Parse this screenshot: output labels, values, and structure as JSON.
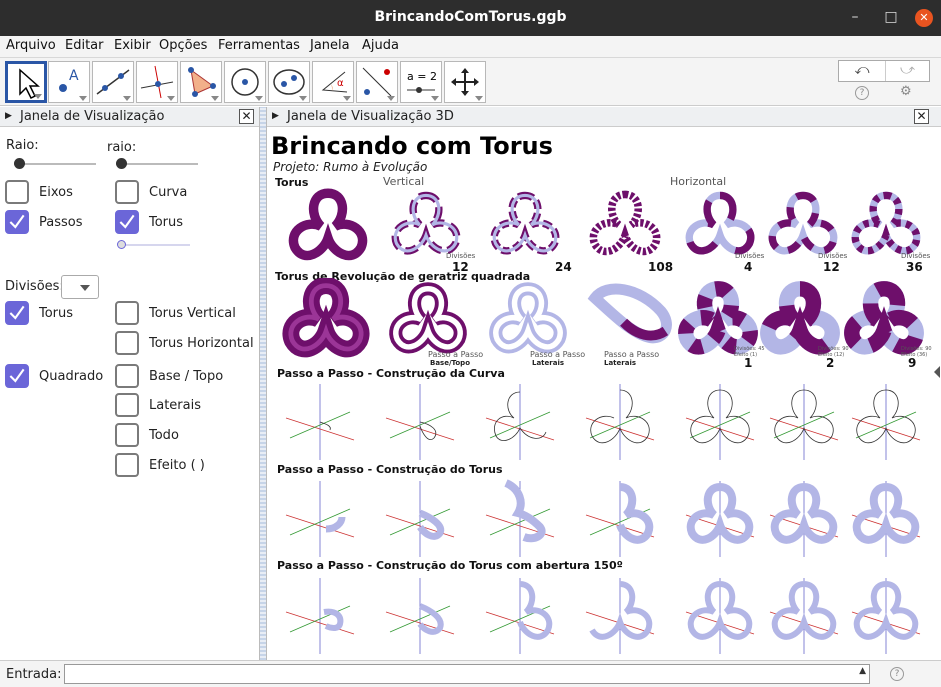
{
  "window": {
    "title": "BrincandoComTorus.ggb",
    "minimize": "–",
    "maximize": "□",
    "close": "✕"
  },
  "menu": [
    "Arquivo",
    "Editar",
    "Exibir",
    "Opções",
    "Ferramentas",
    "Janela",
    "Ajuda"
  ],
  "toolbar": {
    "tool7_label": "a = 2"
  },
  "left_panel": {
    "title": "Janela de Visualização",
    "raio_label": "Raio:",
    "raio2_label": "raio:",
    "eixos": "Eixos",
    "passos": "Passos",
    "curva": "Curva",
    "torus": "Torus",
    "divisoes": "Divisões:",
    "torus2": "Torus",
    "torus_vertical": "Torus Vertical",
    "torus_horizontal": "Torus Horizontal",
    "quadrado": "Quadrado",
    "base_topo": "Base / Topo",
    "laterais": "Laterais",
    "todo": "Todo",
    "efeito": "Efeito (       )"
  },
  "right_panel": {
    "title": "Janela de Visualização 3D",
    "heading": "Brincando com Torus",
    "subheading": "Projeto: Rumo à Evolução",
    "row1_label": "Torus",
    "vertical": "Vertical",
    "horizontal": "Horizontal",
    "divisoes_small": "Divisões",
    "row1_nums": [
      "12",
      "24",
      "108",
      "4",
      "12",
      "36"
    ],
    "row2_label": "Torus de Revolução de geratriz quadrada",
    "passo_a_passo": "Passo a Passo",
    "base_topo": "Base/Topo",
    "laterais": "Laterais",
    "row2_nums": [
      "1",
      "2",
      "9"
    ],
    "row2_small": [
      "Divisões: 45\nEfeito (1)",
      "Divisões: 90\nEfeito (12)",
      "Divisões: 90\nEfeito (36)"
    ],
    "row3_label": "Passo a Passo - Construção da Curva",
    "row4_label": "Passo a Passo - Construção do Torus",
    "row5_label": "Passo a Passo - Construção do Torus com abertura 150º"
  },
  "bottom": {
    "entrada_label": "Entrada:"
  },
  "colors": {
    "accent": "#6b66d8",
    "torus_purple": "#6e0f6b",
    "torus_lavender": "#b3b6e6",
    "selection": "#2a56a6"
  }
}
